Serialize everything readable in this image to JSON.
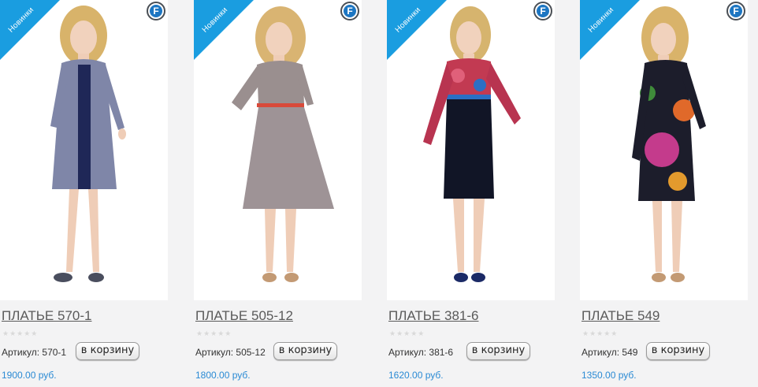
{
  "badge_label": "Новинки",
  "brand_badge_letter": "F",
  "colors": {
    "ribbon": "#1a9de0",
    "price": "#2a8ad4",
    "brand": "#1d76c2"
  },
  "products": [
    {
      "title": "ПЛАТЬЕ 570-1",
      "sku": "Артикул: 570-1",
      "cart_label": "в корзину",
      "price": "1900.00 руб.",
      "rating_stars": 0,
      "max_stars": 5
    },
    {
      "title": "ПЛАТЬЕ 505-12",
      "sku": "Артикул: 505-12",
      "cart_label": "в корзину",
      "price": "1800.00 руб.",
      "rating_stars": 0,
      "max_stars": 5
    },
    {
      "title": "ПЛАТЬЕ 381-6",
      "sku": "Артикул: 381-6",
      "cart_label": "в корзину",
      "price": "1620.00 руб.",
      "rating_stars": 0,
      "max_stars": 5
    },
    {
      "title": "ПЛАТЬЕ 549",
      "sku": "Артикул: 549",
      "cart_label": "в корзину",
      "price": "1350.00 руб.",
      "rating_stars": 0,
      "max_stars": 5
    }
  ]
}
